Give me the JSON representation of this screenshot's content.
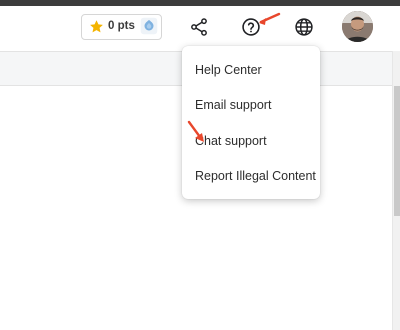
{
  "header": {
    "points_label": "0 pts",
    "icons": {
      "star": "star-icon",
      "gem": "gem-icon",
      "share": "share-icon",
      "help": "help-icon",
      "globe": "globe-icon",
      "avatar": "avatar"
    }
  },
  "help_menu": {
    "items": [
      {
        "label": "Help Center"
      },
      {
        "label": "Email support"
      },
      {
        "label": "Chat support"
      },
      {
        "label": "Report Illegal Content"
      }
    ]
  },
  "colors": {
    "star": "#f4b400",
    "annotation_arrow": "#e8472c",
    "gem": "#7fb2e0",
    "subbar_bg": "#f5f6f7"
  }
}
